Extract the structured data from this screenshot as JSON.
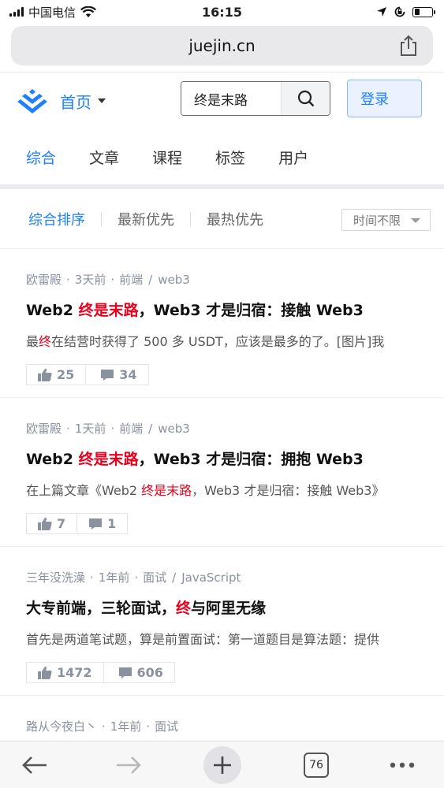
{
  "status": {
    "carrier": "中国电信",
    "time": "16:15"
  },
  "browser": {
    "url": "juejin.cn",
    "tab_count": "76"
  },
  "header": {
    "home_label": "首页",
    "search_value": "终是末路",
    "login_label": "登录"
  },
  "nav_tabs": [
    "综合",
    "文章",
    "课程",
    "标签",
    "用户"
  ],
  "sort": {
    "options": [
      "综合排序",
      "最新优先",
      "最热优先"
    ],
    "time_filter": "时间不限"
  },
  "articles": [
    {
      "author": "欧雷殿",
      "time": "3天前",
      "tag1": "前端",
      "tag2": "web3",
      "title_parts": [
        "Web2 ",
        "终是末路",
        "，Web3 才是归宿：接触 Web3"
      ],
      "abstract_parts": [
        "最",
        "终",
        "在结营时获得了 500 多 USDT，应该是最多的了。[图片]我"
      ],
      "likes": "25",
      "comments": "34"
    },
    {
      "author": "欧雷殿",
      "time": "1天前",
      "tag1": "前端",
      "tag2": "web3",
      "title_parts": [
        "Web2 ",
        "终是末路",
        "，Web3 才是归宿：拥抱 Web3"
      ],
      "abstract_parts": [
        "在上篇文章《Web2 ",
        "终是末路",
        "，Web3 才是归宿：接触 Web3》"
      ],
      "likes": "7",
      "comments": "1"
    },
    {
      "author": "三年没洗澡",
      "time": "1年前",
      "tag1": "面试",
      "tag2": "JavaScript",
      "title_parts": [
        "大专前端，三轮面试，",
        "终",
        "与阿里无缘"
      ],
      "abstract_parts": [
        "首先是两道笔试题，算是前置面试：第一道题目是算法题：提供"
      ],
      "likes": "1472",
      "comments": "606"
    },
    {
      "author": "路从今夜白丶",
      "time": "1年前",
      "tag1": "面试"
    }
  ],
  "colors": {
    "accent": "#1e80ff",
    "highlight": "#e8001c"
  },
  "icons": [
    "wifi-icon",
    "location-icon",
    "rotation-lock-icon",
    "battery-icon",
    "share-icon",
    "juejin-logo-icon",
    "search-icon",
    "thumbs-up-icon",
    "comment-icon",
    "back-arrow-icon",
    "forward-arrow-icon",
    "plus-icon",
    "more-icon"
  ]
}
